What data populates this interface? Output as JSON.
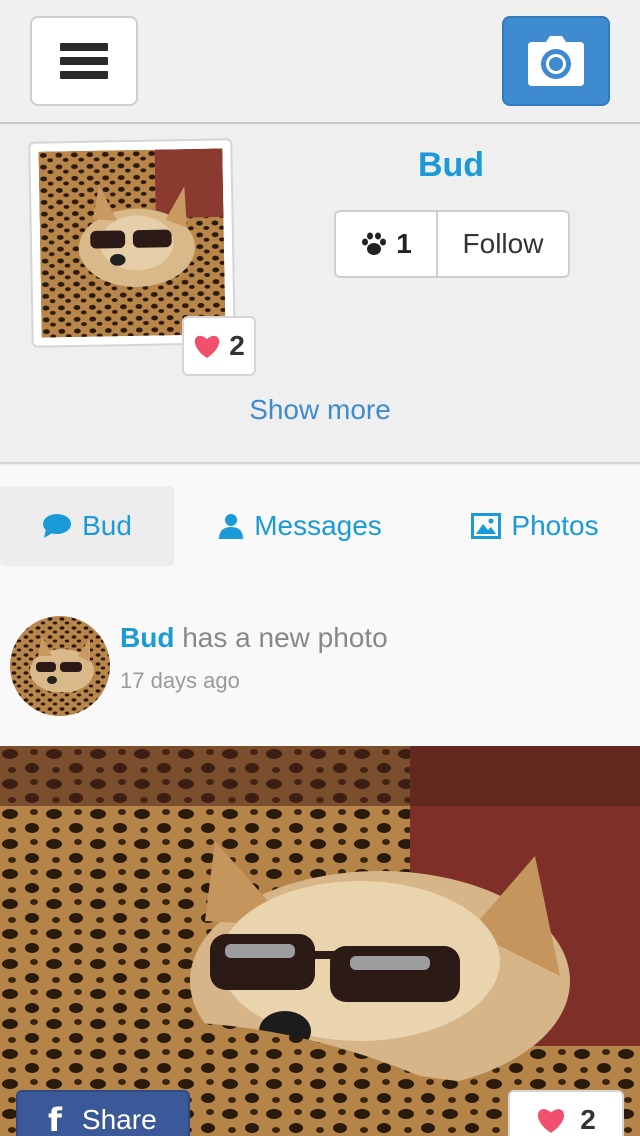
{
  "header": {
    "menu_icon": "hamburger-menu-icon",
    "camera_icon": "camera-icon"
  },
  "profile": {
    "name": "Bud",
    "like_count": "2",
    "followers_count": "1",
    "follow_label": "Follow",
    "show_more_label": "Show more"
  },
  "tabs": [
    {
      "label": "Bud",
      "icon": "speech-bubble-icon",
      "active": true
    },
    {
      "label": "Messages",
      "icon": "person-icon",
      "active": false
    },
    {
      "label": "Photos",
      "icon": "picture-icon",
      "active": false
    }
  ],
  "feed": {
    "author": "Bud",
    "action": "has a new photo",
    "time": "17 days ago",
    "share_label": "Share",
    "like_count": "2"
  },
  "colors": {
    "accent": "#1a9ad6",
    "camera_button": "#3f8bd0",
    "facebook": "#3b5998",
    "heart": "#f0506e"
  }
}
